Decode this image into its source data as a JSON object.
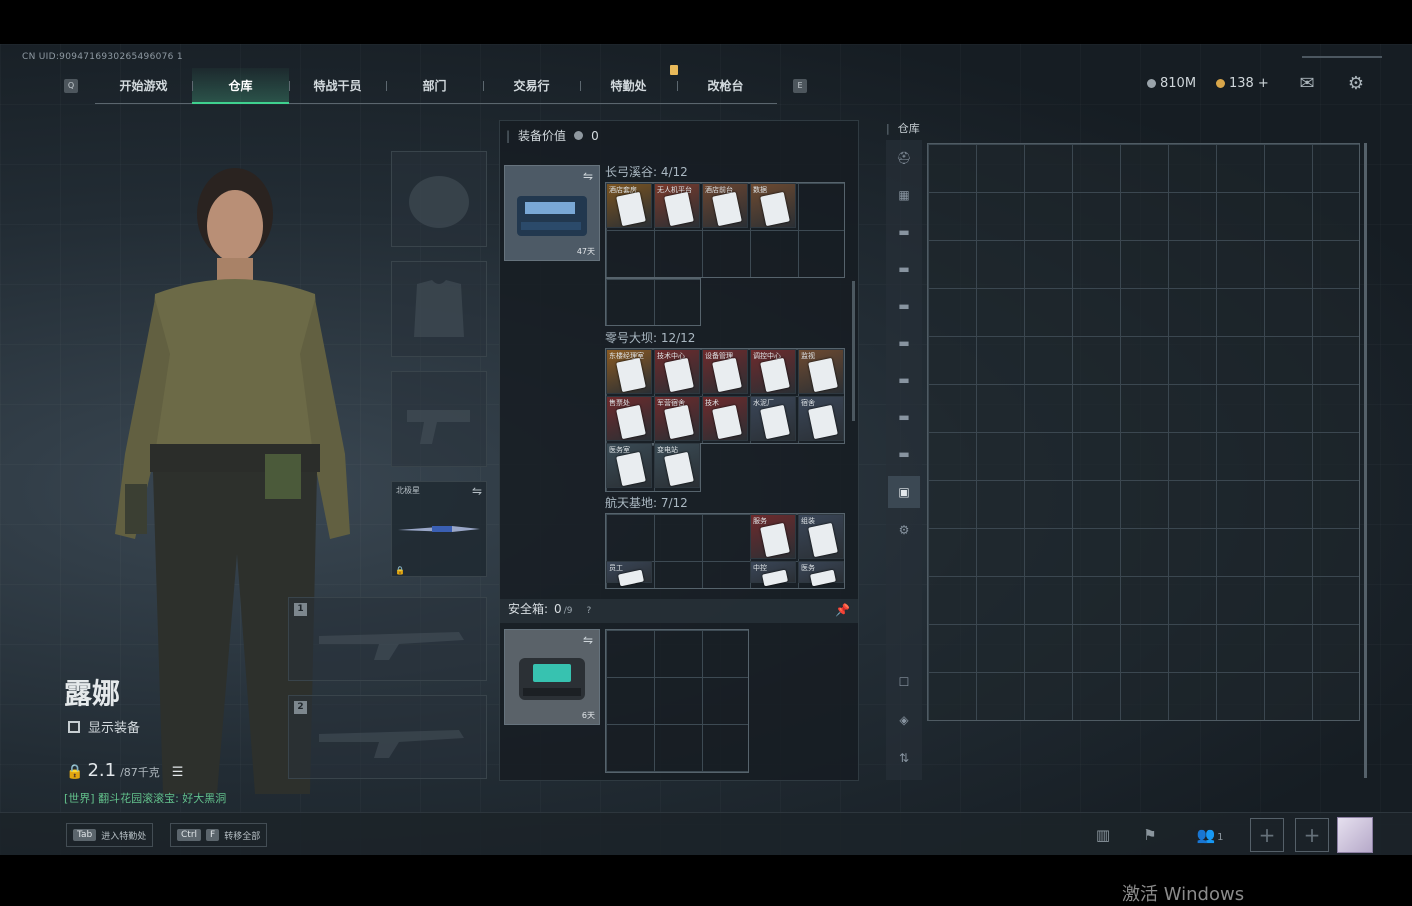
{
  "uid_text": "CN UID:9094716930265496076 1",
  "nav": {
    "left_key": "Q",
    "right_key": "E",
    "tabs": [
      {
        "label": "开始游戏"
      },
      {
        "label": "仓库",
        "active": true
      },
      {
        "label": "特战干员"
      },
      {
        "label": "部门"
      },
      {
        "label": "交易行"
      },
      {
        "label": "特勤处"
      },
      {
        "label": "改枪台"
      }
    ]
  },
  "currency": {
    "silver": "810M",
    "gold": "138",
    "gold_plus": "+",
    "silver_color": "#9aa3aa",
    "gold_color": "#d8a64a"
  },
  "icons": {
    "mail": "mail-icon",
    "settings": "gear-icon"
  },
  "operator": {
    "name": "露娜",
    "show_equipment": "显示装备",
    "weight": "2.1",
    "weight_max": "/87千克"
  },
  "chat": {
    "text": "[世界] 翻斗花园滚滚宝: 好大黑洞"
  },
  "equip_slots": {
    "melee_label": "北极星",
    "weapon1": "1",
    "weapon2": "2"
  },
  "equipment_panel": {
    "title": "装备价值",
    "value": "0",
    "bag_timer": "47天",
    "sections": [
      {
        "title": "长弓溪谷: 4/12",
        "cards": [
          {
            "label": "酒店套房",
            "color": "#7b5420"
          },
          {
            "label": "无人机平台",
            "color": "#7a3a2c"
          },
          {
            "label": "酒店前台",
            "color": "#6b4530"
          },
          {
            "label": "数据",
            "color": "#6e4a30"
          }
        ]
      },
      {
        "title": "零号大坝: 12/12",
        "cards": [
          {
            "label": "东楼经理室",
            "color": "#8a5a22"
          },
          {
            "label": "技术中心",
            "color": "#6e2a2c"
          },
          {
            "label": "设备管理",
            "color": "#6e2a2c"
          },
          {
            "label": "调控中心",
            "color": "#6e2a2c"
          },
          {
            "label": "监视",
            "color": "#6e4a30"
          },
          {
            "label": "售票处",
            "color": "#6e2a2c"
          },
          {
            "label": "军营宿舍",
            "color": "#6e2a2c"
          },
          {
            "label": "技术",
            "color": "#6e2a2c"
          },
          {
            "label": "水泥厂",
            "color": "#3a4658"
          },
          {
            "label": "宿舍",
            "color": "#3a4658"
          },
          {
            "label": "医务室",
            "color": "#3a4b55"
          },
          {
            "label": "变电站",
            "color": "#3a4b55"
          }
        ]
      },
      {
        "title": "航天基地: 7/12",
        "cards": [
          {
            "label": "服务",
            "color": "#6e2a2c"
          },
          {
            "label": "组装",
            "color": "#3a4658"
          },
          {
            "label": "员工",
            "color": "#3a4658"
          },
          {
            "label": "中控",
            "color": "#3a4658"
          },
          {
            "label": "医务",
            "color": "#3a4658"
          }
        ]
      }
    ],
    "safe_box": {
      "title": "安全箱:",
      "value": "0",
      "max": "/9",
      "help": "?",
      "timer": "6天"
    }
  },
  "warehouse": {
    "title": "仓库"
  },
  "bottom": {
    "tab_key": "Tab",
    "tab_label": "进入特勤处",
    "ctrl_key": "Ctrl",
    "f_key": "F",
    "transfer_label": "转移全部",
    "team_count": "1"
  },
  "watermark": "激活 Windows"
}
